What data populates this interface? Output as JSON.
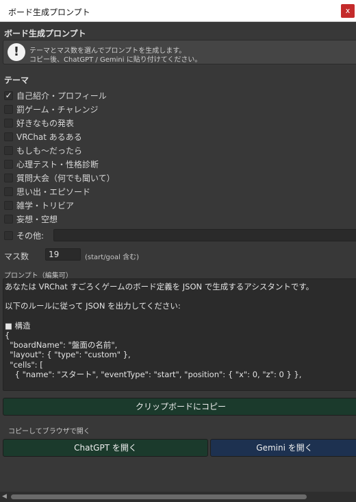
{
  "window": {
    "title": "ボード生成プロンプト",
    "close_label": "x"
  },
  "heading": "ボード生成プロンプト",
  "help": {
    "icon": "exclamation-info-icon",
    "line1": "テーマとマス数を選んでプロンプトを生成します。",
    "line2": "コピー後、ChatGPT / Gemini に貼り付けてください。"
  },
  "themes": {
    "title": "テーマ",
    "items": [
      {
        "label": "自己紹介・プロフィール",
        "checked": true
      },
      {
        "label": "罰ゲーム・チャレンジ",
        "checked": false
      },
      {
        "label": "好きなもの発表",
        "checked": false
      },
      {
        "label": "VRChat あるある",
        "checked": false
      },
      {
        "label": "もしも〜だったら",
        "checked": false
      },
      {
        "label": "心理テスト・性格診断",
        "checked": false
      },
      {
        "label": "質問大会（何でも聞いて）",
        "checked": false
      },
      {
        "label": "思い出・エピソード",
        "checked": false
      },
      {
        "label": "雑学・トリビア",
        "checked": false
      },
      {
        "label": "妄想・空想",
        "checked": false
      }
    ],
    "other": {
      "label": "その他:",
      "checked": false,
      "value": ""
    }
  },
  "masu": {
    "label": "マス数",
    "value": "19",
    "hint": "(start/goal 含む)"
  },
  "prompt": {
    "label": "プロンプト（編集可）",
    "lines": [
      "あなたは VRChat すごろくゲームのボード定義を JSON で生成するアシスタントです。",
      "",
      "以下のルールに従って JSON を出力してください:",
      "",
      "■ 構造",
      "{",
      "  \"boardName\": \"盤面の名前\",",
      "  \"layout\": { \"type\": \"custom\" },",
      "  \"cells\": [",
      "    { \"name\": \"スタート\", \"eventType\": \"start\", \"position\": { \"x\": 0, \"z\": 0 } },"
    ]
  },
  "buttons": {
    "copy": "クリップボードにコピー",
    "open_label": "コピーしてブラウザで開く",
    "chatgpt": "ChatGPT を開く",
    "gemini": "Gemini を開く"
  },
  "colors": {
    "background": "#383838",
    "green_button": "#1b3a2c",
    "blue_button": "#1d3150"
  }
}
